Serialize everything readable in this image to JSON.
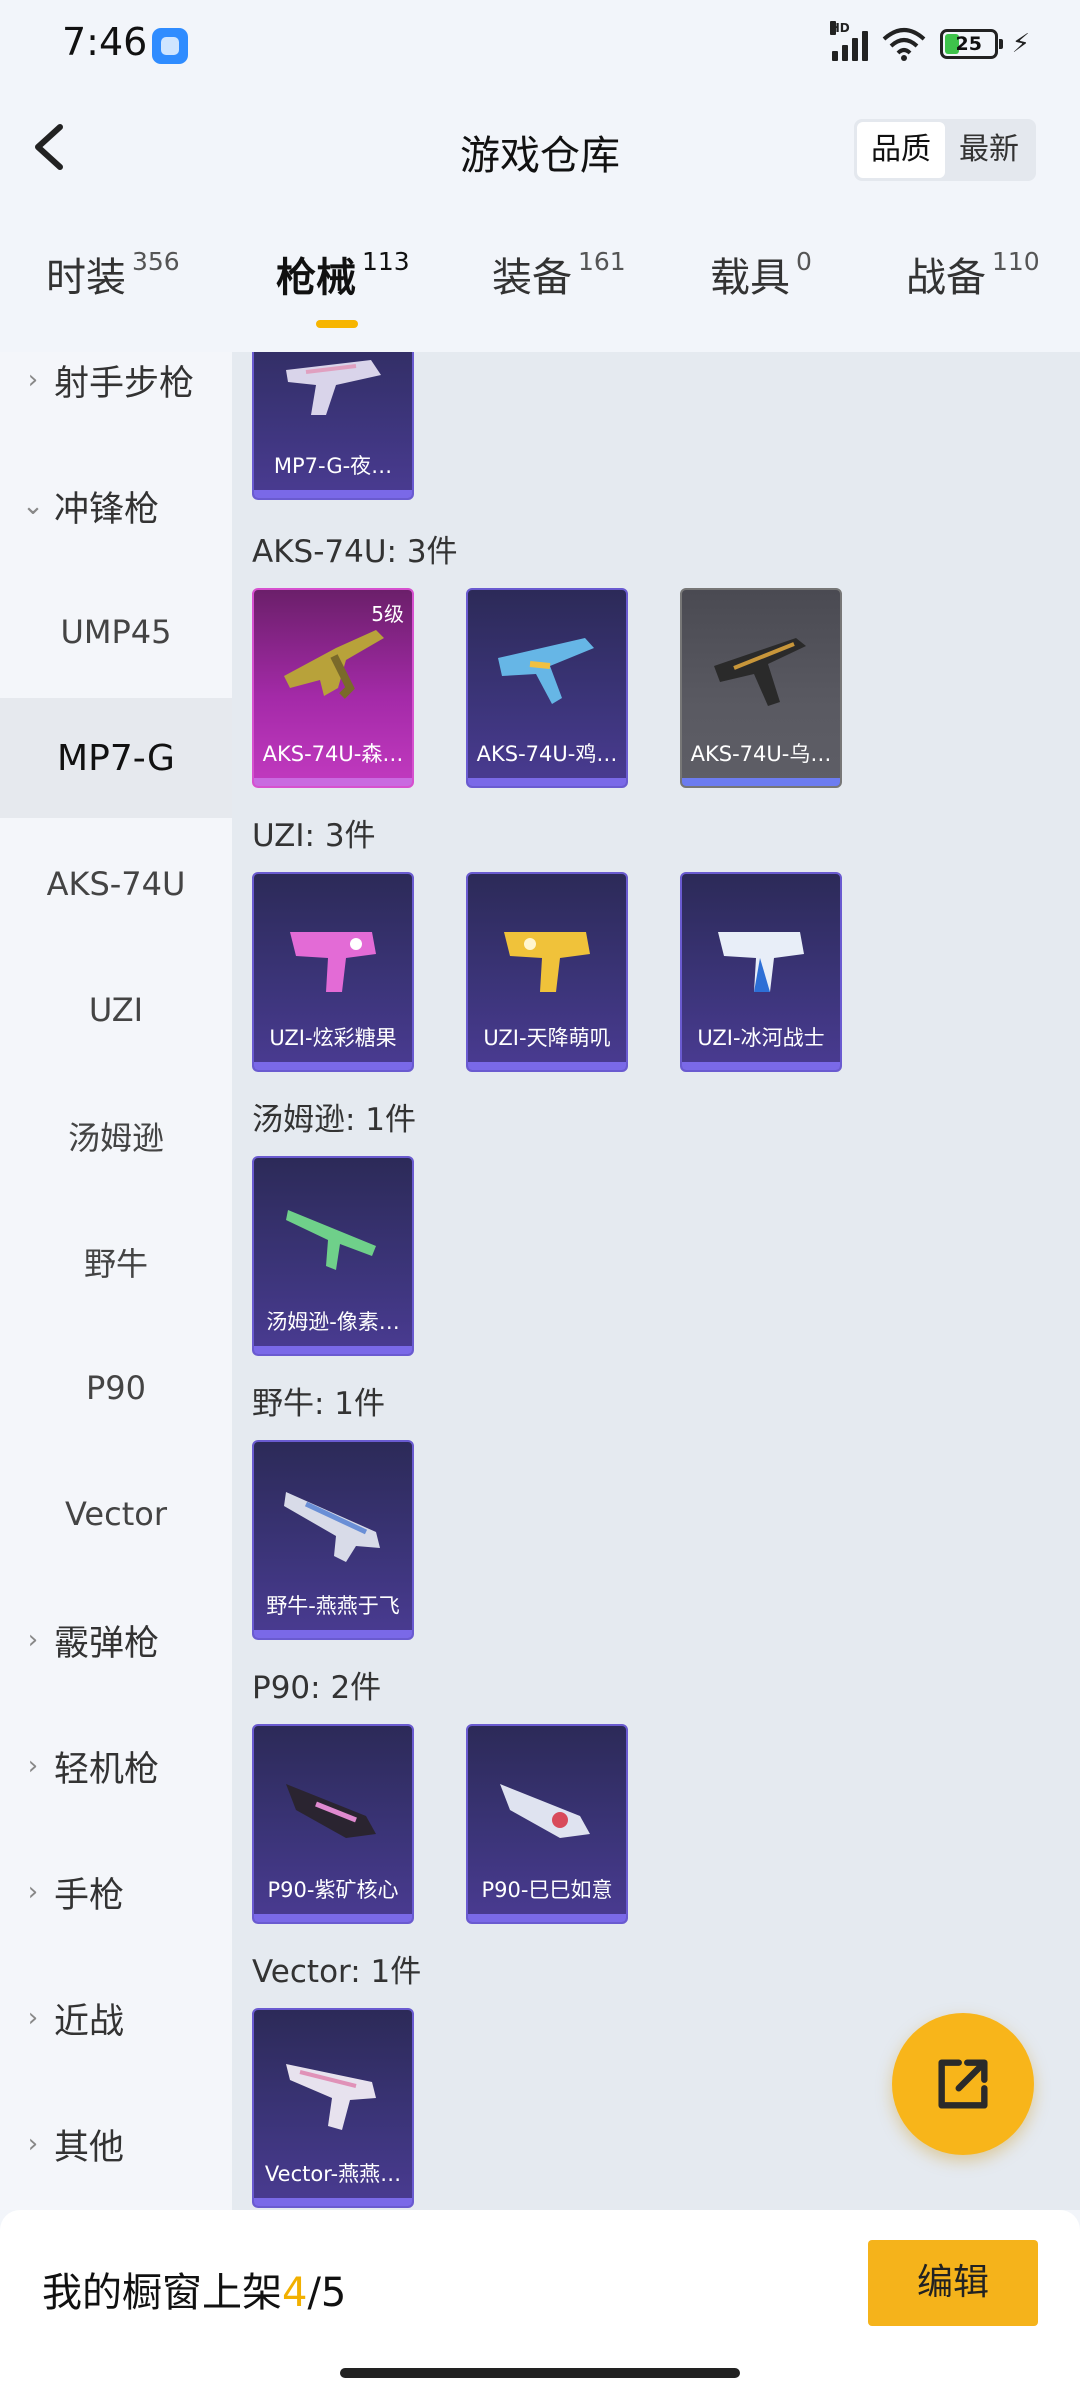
{
  "status": {
    "time": "7:46",
    "network": "HD",
    "battery": "25"
  },
  "header": {
    "title": "游戏仓库",
    "sort_quality": "品质",
    "sort_newest": "最新"
  },
  "tabs": [
    {
      "label": "时装",
      "count": "356"
    },
    {
      "label": "枪械",
      "count": "113"
    },
    {
      "label": "装备",
      "count": "161"
    },
    {
      "label": "载具",
      "count": "0"
    },
    {
      "label": "战备",
      "count": "110"
    }
  ],
  "sidebar": {
    "items": [
      {
        "label": "射手步枪"
      },
      {
        "label": "冲锋枪"
      },
      {
        "label": "UMP45"
      },
      {
        "label": "MP7-G"
      },
      {
        "label": "AKS-74U"
      },
      {
        "label": "UZI"
      },
      {
        "label": "汤姆逊"
      },
      {
        "label": "野牛"
      },
      {
        "label": "P90"
      },
      {
        "label": "Vector"
      },
      {
        "label": "霰弹枪"
      },
      {
        "label": "轻机枪"
      },
      {
        "label": "手枪"
      },
      {
        "label": "近战"
      },
      {
        "label": "其他"
      }
    ]
  },
  "content": {
    "groups": [
      {
        "title": "",
        "items": [
          {
            "name": "MP7-G-夜…"
          }
        ]
      },
      {
        "title": "AKS-74U: 3件",
        "items": [
          {
            "name": "AKS-74U-森…",
            "badge": "5级"
          },
          {
            "name": "AKS-74U-鸡…"
          },
          {
            "name": "AKS-74U-乌…"
          }
        ]
      },
      {
        "title": "UZI: 3件",
        "items": [
          {
            "name": "UZI-炫彩糖果"
          },
          {
            "name": "UZI-天降萌叽"
          },
          {
            "name": "UZI-冰河战士"
          }
        ]
      },
      {
        "title": "汤姆逊: 1件",
        "items": [
          {
            "name": "汤姆逊-像素…"
          }
        ]
      },
      {
        "title": "野牛: 1件",
        "items": [
          {
            "name": "野牛-燕燕于飞"
          }
        ]
      },
      {
        "title": "P90: 2件",
        "items": [
          {
            "name": "P90-紫矿核心"
          },
          {
            "name": "P90-巳巳如意"
          }
        ]
      },
      {
        "title": "Vector: 1件",
        "items": [
          {
            "name": "Vector-燕燕…"
          }
        ]
      }
    ]
  },
  "bottom": {
    "label": "我的橱窗上架",
    "current": "4",
    "total": "/5",
    "edit": "编辑"
  },
  "colors": {
    "accent": "#f7b500",
    "card_purple": "#3b3478",
    "card_pink": "#a42aa8",
    "card_grey": "#5a5a62"
  }
}
